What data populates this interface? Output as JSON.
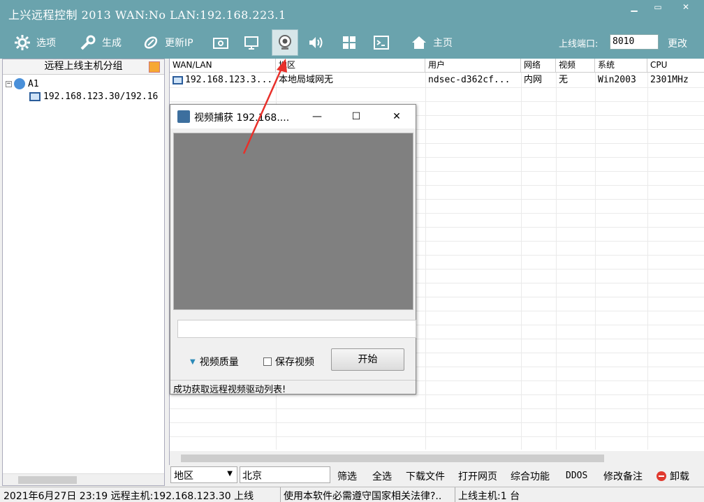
{
  "window": {
    "title": "上兴远程控制 2013 WAN:No LAN:192.168.223.1"
  },
  "toolbar": {
    "options": "选项",
    "generate": "生成",
    "update_ip": "更新IP",
    "homepage": "主页",
    "port_label": "上线端口:",
    "port_value": "8010",
    "change": "更改"
  },
  "sidebar": {
    "header": "远程上线主机分组",
    "group": "A1",
    "host": "192.168.123.30/192.16"
  },
  "table": {
    "columns": [
      "WAN/LAN",
      "地区",
      "用户",
      "网络",
      "视频",
      "系统",
      "CPU"
    ],
    "rows": [
      {
        "wan": "192.168.123.3...",
        "region": "本地局域网无",
        "user": "ndsec-d362cf...",
        "net": "内网",
        "video": "无",
        "os": "Win2003",
        "cpu": "2301MHz"
      }
    ]
  },
  "bottom": {
    "region_combo": "地区",
    "filter_text": "北京",
    "filter": "筛选",
    "select_all": "全选",
    "download": "下载文件",
    "open_web": "打开网页",
    "composite": "综合功能",
    "ddos": "DDOS",
    "edit_note": "修改备注",
    "uninstall": "卸载"
  },
  "status": {
    "left": "2021年6月27日 23:19 远程主机:192.168.123.30 上线",
    "middle": "使用本软件必需遵守国家相关法律?..",
    "right": "上线主机:1 台"
  },
  "dialog": {
    "title": "视频捕获 192.168....",
    "quality": "视频质量",
    "save": "保存视频",
    "start": "开始",
    "status": "成功获取远程视频驱动列表!"
  },
  "colors": {
    "accent": "#6aa3ad",
    "arrow": "#e8302a",
    "video_bg": "#808080"
  }
}
